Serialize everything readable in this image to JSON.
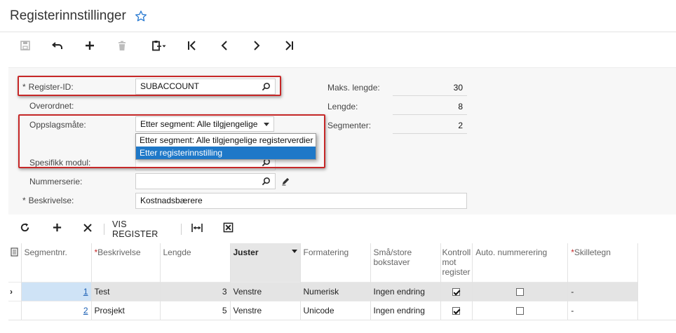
{
  "page": {
    "title": "Registerinnstillinger"
  },
  "toolbar": {
    "save": "save-icon",
    "undo": "undo-icon",
    "add": "plus-icon",
    "delete": "trash-icon",
    "copy_paste": "clipboard-icon",
    "first": "first-icon",
    "prev": "prev-icon",
    "next": "next-icon",
    "last": "last-icon"
  },
  "form": {
    "register_id": {
      "label": "Register-ID:",
      "value": "SUBACCOUNT",
      "required": "*"
    },
    "parent": {
      "label": "Overordnet:"
    },
    "lookup": {
      "label": "Oppslagsmåte:",
      "value": "Etter segment: Alle tilgjengelige",
      "options": [
        "Etter segment: Alle tilgjengelige registerverdier",
        "Etter registerinnstilling"
      ]
    },
    "module": {
      "label": "Spesifikk modul:"
    },
    "numbering": {
      "label": "Nummerserie:",
      "value": ""
    },
    "description": {
      "label": "Beskrivelse:",
      "value": "Kostnadsbærere",
      "required": "*"
    },
    "max_length": {
      "label": "Maks. lengde:",
      "value": "30"
    },
    "length": {
      "label": "Lengde:",
      "value": "8"
    },
    "segments": {
      "label": "Segmenter:",
      "value": "2"
    }
  },
  "grid_toolbar": {
    "view_register": "VIS REGISTER"
  },
  "grid": {
    "headers": {
      "segment_nr": "Segmentnr.",
      "description": "Beskrivelse",
      "length": "Lengde",
      "align": "Juster",
      "format": "Formatering",
      "case": "Små/store bokstaver",
      "validate": "Kontroll mot register",
      "auto_num": "Auto. nummerering",
      "separator": "Skilletegn",
      "required_mark": "*"
    },
    "rows": [
      {
        "nr": "1",
        "desc": "Test",
        "length": "3",
        "align": "Venstre",
        "format": "Numerisk",
        "case": "Ingen endring",
        "validate": true,
        "auto": false,
        "sep": "-"
      },
      {
        "nr": "2",
        "desc": "Prosjekt",
        "length": "5",
        "align": "Venstre",
        "format": "Unicode",
        "case": "Ingen endring",
        "validate": true,
        "auto": false,
        "sep": "-"
      }
    ]
  },
  "colors": {
    "accent": "#1e78c8",
    "highlight_box": "#c62828",
    "star": "#2a7bd2"
  }
}
